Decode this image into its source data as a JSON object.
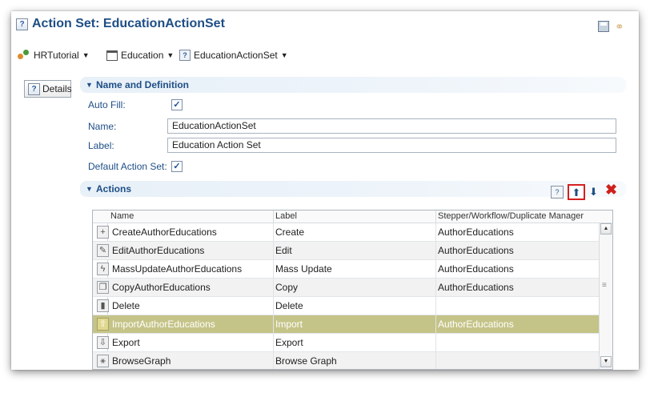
{
  "title": "Action Set: EducationActionSet",
  "breadcrumb": {
    "app": "HRTutorial",
    "entity": "Education",
    "action_set": "EducationActionSet"
  },
  "tabs": {
    "details": "Details"
  },
  "name_section": {
    "header": "Name and Definition",
    "auto_fill_label": "Auto Fill:",
    "auto_fill_checked": "✓",
    "name_label": "Name:",
    "name_value": "EducationActionSet",
    "label_label": "Label:",
    "label_value": "Education Action Set",
    "default_label": "Default Action Set:",
    "default_checked": "✓"
  },
  "actions_section": {
    "header": "Actions",
    "columns": [
      "Name",
      "Label",
      "Stepper/Workflow/Duplicate Manager"
    ],
    "rows": [
      {
        "icon": "plus-icon",
        "name": "CreateAuthorEducations",
        "label": "Create",
        "manager": "AuthorEducations"
      },
      {
        "icon": "pencil-icon",
        "name": "EditAuthorEducations",
        "label": "Edit",
        "manager": "AuthorEducations"
      },
      {
        "icon": "lightning-icon",
        "name": "MassUpdateAuthorEducations",
        "label": "Mass Update",
        "manager": "AuthorEducations"
      },
      {
        "icon": "copy-icon",
        "name": "CopyAuthorEducations",
        "label": "Copy",
        "manager": "AuthorEducations"
      },
      {
        "icon": "trash-icon",
        "name": "Delete",
        "label": "Delete",
        "manager": ""
      },
      {
        "icon": "upload-icon",
        "name": "ImportAuthorEducations",
        "label": "Import",
        "manager": "AuthorEducations"
      },
      {
        "icon": "download-icon",
        "name": "Export",
        "label": "Export",
        "manager": ""
      },
      {
        "icon": "graph-icon",
        "name": "BrowseGraph",
        "label": "Browse Graph",
        "manager": ""
      }
    ]
  },
  "colors": {
    "accent": "#1e4e86",
    "selected_row": "#c5c488",
    "delete": "#d0201c"
  }
}
